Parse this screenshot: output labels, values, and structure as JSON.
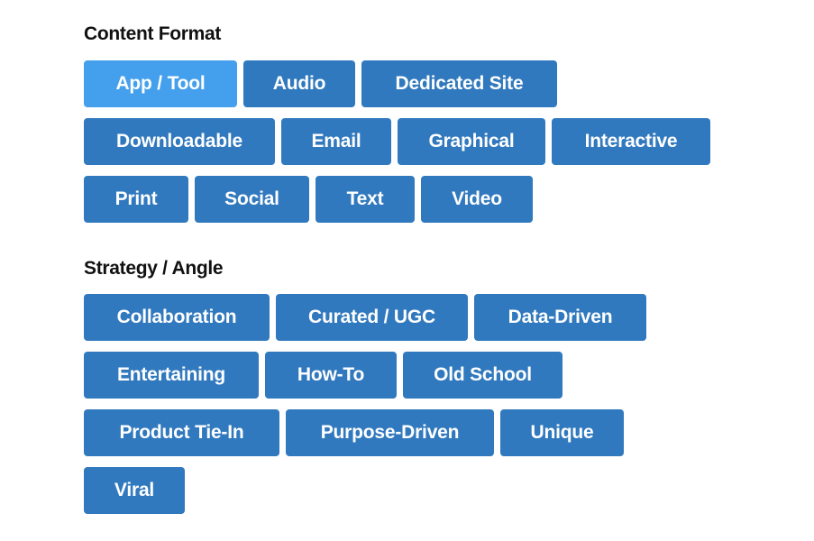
{
  "sections": [
    {
      "title": "Content Format",
      "tags": [
        {
          "label": "App / Tool",
          "active": true
        },
        {
          "label": "Audio",
          "active": false
        },
        {
          "label": "Dedicated Site",
          "active": false
        },
        {
          "label": "Downloadable",
          "active": false
        },
        {
          "label": "Email",
          "active": false
        },
        {
          "label": "Graphical",
          "active": false
        },
        {
          "label": "Interactive",
          "active": false
        },
        {
          "label": "Print",
          "active": false
        },
        {
          "label": "Social",
          "active": false
        },
        {
          "label": "Text",
          "active": false
        },
        {
          "label": "Video",
          "active": false
        }
      ]
    },
    {
      "title": "Strategy / Angle",
      "tags": [
        {
          "label": "Collaboration",
          "active": false
        },
        {
          "label": "Curated / UGC",
          "active": false
        },
        {
          "label": "Data-Driven",
          "active": false
        },
        {
          "label": "Entertaining",
          "active": false
        },
        {
          "label": "How-To",
          "active": false
        },
        {
          "label": "Old School",
          "active": false
        },
        {
          "label": "Product Tie-In",
          "active": false
        },
        {
          "label": "Purpose-Driven",
          "active": false
        },
        {
          "label": "Unique",
          "active": false
        },
        {
          "label": "Viral",
          "active": false
        }
      ]
    }
  ],
  "colors": {
    "tag": "#3179be",
    "tag_active": "#44a0ec",
    "text": "#111111"
  }
}
